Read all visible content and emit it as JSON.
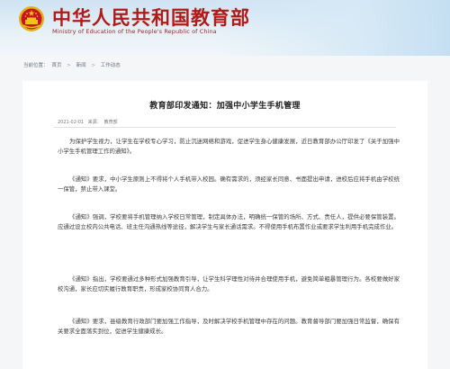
{
  "header": {
    "title": "中华人民共和国教育部",
    "subtitle": "Ministry of Education of the People's Republic of China"
  },
  "breadcrumb": {
    "label": "当前位置：",
    "items": [
      "首页",
      "新闻",
      "工作动态"
    ],
    "separator": ">"
  },
  "article": {
    "title": "教育部印发通知：加强中小学生手机管理",
    "date": "2021-02-01",
    "source_label": "来源：",
    "source": "教育部",
    "paragraphs": [
      "为保护学生视力，让学生在学校专心学习，防止沉迷网络和游戏，促进学生身心健康发展，近日教育部办公厅印发了《关于加强中小学生手机管理工作的通知》。",
      "《通知》要求，中小学生原则上不得将个人手机带入校园。确有需求的，须经家长同意、书面提出申请，进校后应将手机由学校统一保管，禁止带入课堂。",
      "《通知》强调，学校要将手机管理纳入学校日常管理，制定具体办法，明确统一保管的场所、方式、责任人，提供必要保管装置。应通过设立校内公共电话、班主任沟通热线等途径，解决学生与家长通话需求。不得使用手机布置作业或要求学生利用手机完成作业。",
      "《通知》指出，学校要通过多种形式加强教育引导，让学生科学理性对待并合理使用手机，避免简单粗暴管理行为。各校要做好家校沟通，家长应切实履行教育职责，形成家校协同育人合力。",
      "《通知》要求，县级教育行政部门要加强工作指导，及时解决学校手机管理中存在的问题。教育督导部门要加强日常监督，确保有关要求全面落实到位，促进学生健康成长。"
    ]
  },
  "colors": {
    "title_red": "#b01a17",
    "banner_blue": "#cfe3f2",
    "emblem_gold": "#f2c21a"
  },
  "icons": [
    "national-emblem-icon"
  ]
}
